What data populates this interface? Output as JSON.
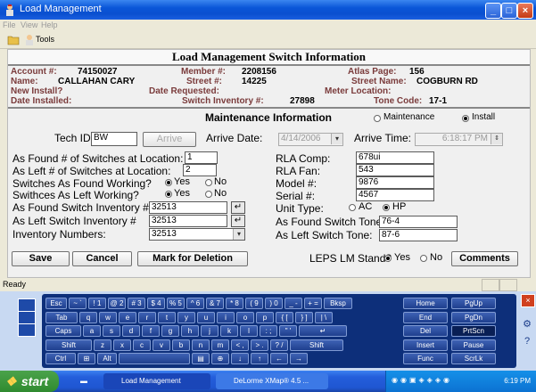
{
  "window": {
    "title": "Load Management"
  },
  "menu": [
    "File",
    "View",
    "Help"
  ],
  "toolbar": {
    "tools_label": "Tools"
  },
  "form": {
    "header": "Load Management Switch Information",
    "account_label": "Account #:",
    "account_value": "74150027",
    "member_label": "Member #:",
    "member_value": "2208156",
    "atlas_label": "Atlas Page:",
    "atlas_value": "156",
    "name_label": "Name:",
    "name_value": "CALLAHAN CARY",
    "street_no_label": "Street #:",
    "street_no_value": "14225",
    "street_name_label": "Street Name:",
    "street_name_value": "COGBURN RD",
    "new_install_label": "New Install?",
    "date_requested_label": "Date Requested:",
    "meter_location_label": "Meter Location:",
    "date_installed_label": "Date Installed:",
    "switch_inventory_label": "Switch Inventory #:",
    "switch_inventory_value": "27898",
    "tone_code_label": "Tone Code:",
    "tone_code_value": "17-1"
  },
  "maint": {
    "title": "Maintenance Information",
    "mode_options": [
      "Maintenance",
      "Install"
    ],
    "mode_selected": "Install",
    "tech_id_label": "Tech ID",
    "tech_id_value": "BW",
    "arrive_button": "Arrive",
    "arrive_date_label": "Arrive Date:",
    "arrive_date_value": "4/14/2006",
    "arrive_time_label": "Arrive Time:",
    "arrive_time_value": "6:18:17 PM",
    "found_count_label": "As Found # of Switches at Location:",
    "found_count_value": "1",
    "left_count_label": "As Left # of Switches at Location:",
    "left_count_value": "2",
    "found_working_label": "Switches As Found Working?",
    "left_working_label": "Swithces As Left Working?",
    "yes_label": "Yes",
    "no_label": "No",
    "found_inv_label": "As Found Switch Inventory #",
    "found_inv_value": "32513",
    "left_inv_label": "As Left Switch Inventory #",
    "left_inv_value": "32513",
    "inv_numbers_label": "Inventory Numbers:",
    "inv_numbers_value": "32513",
    "rla_comp_label": "RLA Comp:",
    "rla_comp_value": "678ui",
    "rla_fan_label": "RLA Fan:",
    "rla_fan_value": "543",
    "model_label": "Model #:",
    "model_value": "9876",
    "serial_label": "Serial #:",
    "serial_value": "4567",
    "unit_type_label": "Unit Type:",
    "unit_type_ac": "AC",
    "unit_type_hp": "HP",
    "found_tone_label": "As Found Switch Tone:",
    "found_tone_value": "76-4",
    "left_tone_label": "As Left Switch Tone:",
    "left_tone_value": "87-6",
    "leps_label": "LEPS LM Stand?",
    "save_button": "Save",
    "cancel_button": "Cancel",
    "delete_button": "Mark for Deletion",
    "comments_button": "Comments"
  },
  "status": {
    "text": "Ready"
  },
  "keyboard": {
    "rows": [
      [
        "Esc",
        "~ `",
        "! 1",
        "@ 2",
        "# 3",
        "$ 4",
        "% 5",
        "^ 6",
        "& 7",
        "* 8",
        "( 9",
        ") 0",
        "_ -",
        "+ =",
        "Bksp"
      ],
      [
        "Tab",
        "q",
        "w",
        "e",
        "r",
        "t",
        "y",
        "u",
        "i",
        "o",
        "p",
        "{ [",
        "} ]",
        "| \\"
      ],
      [
        "Caps",
        "a",
        "s",
        "d",
        "f",
        "g",
        "h",
        "j",
        "k",
        "l",
        ": ;",
        "\" '",
        "↵"
      ],
      [
        "Shift",
        "z",
        "x",
        "c",
        "v",
        "b",
        "n",
        "m",
        "< ,",
        "> .",
        "? /",
        "Shift"
      ],
      [
        "Ctrl",
        "⊞",
        "Alt",
        "",
        "▤",
        "⊕",
        "↓",
        "↑",
        "←",
        "→"
      ]
    ],
    "nav": [
      [
        "Home",
        "PgUp"
      ],
      [
        "End",
        "PgDn"
      ],
      [
        "Del",
        "PrtScn"
      ],
      [
        "Insert",
        "Pause"
      ],
      [
        "Func",
        "ScrLk"
      ]
    ]
  },
  "taskbar": {
    "start_label": "start",
    "tasks": [
      "Load Management",
      "DeLorme XMap® 4.5 ..."
    ],
    "clock": "6:19 PM"
  }
}
